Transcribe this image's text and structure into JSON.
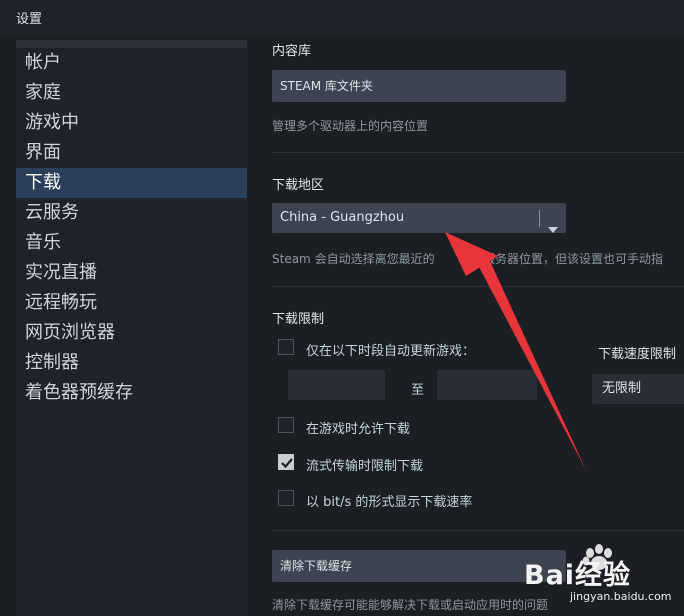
{
  "window": {
    "title": "设置"
  },
  "sidebar": {
    "items": [
      {
        "label": "帐户"
      },
      {
        "label": "家庭"
      },
      {
        "label": "游戏中"
      },
      {
        "label": "界面"
      },
      {
        "label": "下载",
        "active": true
      },
      {
        "label": "云服务"
      },
      {
        "label": "音乐"
      },
      {
        "label": "实况直播"
      },
      {
        "label": "远程畅玩"
      },
      {
        "label": "网页浏览器"
      },
      {
        "label": "控制器"
      },
      {
        "label": "着色器预缓存"
      }
    ]
  },
  "content_library": {
    "heading": "内容库",
    "button_label": "STEAM 库文件夹",
    "description": "管理多个驱动器上的内容位置"
  },
  "download_region": {
    "heading": "下载地区",
    "selected": "China - Guangzhou",
    "description_left": "Steam 会自动选择离您最近的",
    "description_right": "载服务器位置，但该设置也可手动指"
  },
  "download_limits": {
    "heading": "下载限制",
    "auto_update_label": "仅在以下时段自动更新游戏：",
    "auto_update_checked": false,
    "time_to": "至",
    "speed_limit_label": "下载速度限制",
    "speed_limit_value": "无限制",
    "allow_during_game_label": "在游戏时允许下载",
    "allow_during_game_checked": false,
    "throttle_streaming_label": "流式传输时限制下载",
    "throttle_streaming_checked": true,
    "bits_display_label": "以 bit/s 的形式显示下载速率",
    "bits_display_checked": false
  },
  "download_cache": {
    "button_label": "清除下载缓存",
    "description": "清除下载缓存可能能够解决下载或启动应用时的问题"
  },
  "watermark": {
    "text": "Bai经验",
    "url": "jingyan.baidu.com"
  },
  "colors": {
    "annotation_arrow": "#e8353a",
    "active_nav": "#2a3f5a"
  }
}
